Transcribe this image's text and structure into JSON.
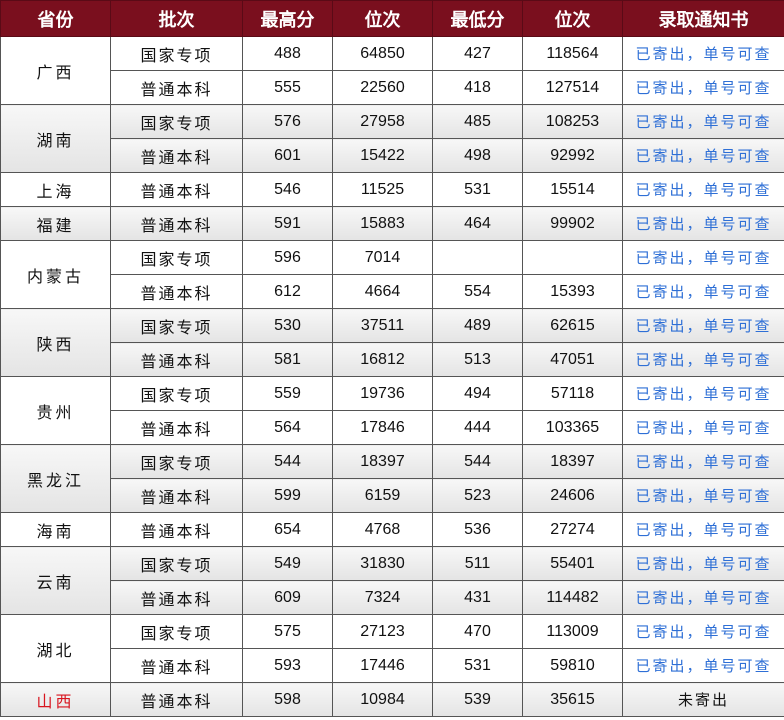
{
  "header": [
    "省份",
    "批次",
    "最高分",
    "位次",
    "最低分",
    "位次",
    "录取通知书"
  ],
  "groups": [
    {
      "province": "广西",
      "rows": [
        {
          "batch": "国家专项",
          "max": "488",
          "rank_max": "64850",
          "min": "427",
          "rank_min": "118564",
          "notice": "已寄出，单号可查"
        },
        {
          "batch": "普通本科",
          "max": "555",
          "rank_max": "22560",
          "min": "418",
          "rank_min": "127514",
          "notice": "已寄出，单号可查"
        }
      ]
    },
    {
      "province": "湖南",
      "rows": [
        {
          "batch": "国家专项",
          "max": "576",
          "rank_max": "27958",
          "min": "485",
          "rank_min": "108253",
          "notice": "已寄出，单号可查"
        },
        {
          "batch": "普通本科",
          "max": "601",
          "rank_max": "15422",
          "min": "498",
          "rank_min": "92992",
          "notice": "已寄出，单号可查"
        }
      ]
    },
    {
      "province": "上海",
      "rows": [
        {
          "batch": "普通本科",
          "max": "546",
          "rank_max": "11525",
          "min": "531",
          "rank_min": "15514",
          "notice": "已寄出，单号可查"
        }
      ]
    },
    {
      "province": "福建",
      "rows": [
        {
          "batch": "普通本科",
          "max": "591",
          "rank_max": "15883",
          "min": "464",
          "rank_min": "99902",
          "notice": "已寄出，单号可查"
        }
      ]
    },
    {
      "province": "内蒙古",
      "rows": [
        {
          "batch": "国家专项",
          "max": "596",
          "rank_max": "7014",
          "min": "",
          "rank_min": "",
          "notice": "已寄出，单号可查"
        },
        {
          "batch": "普通本科",
          "max": "612",
          "rank_max": "4664",
          "min": "554",
          "rank_min": "15393",
          "notice": "已寄出，单号可查"
        }
      ]
    },
    {
      "province": "陕西",
      "rows": [
        {
          "batch": "国家专项",
          "max": "530",
          "rank_max": "37511",
          "min": "489",
          "rank_min": "62615",
          "notice": "已寄出，单号可查"
        },
        {
          "batch": "普通本科",
          "max": "581",
          "rank_max": "16812",
          "min": "513",
          "rank_min": "47051",
          "notice": "已寄出，单号可查"
        }
      ]
    },
    {
      "province": "贵州",
      "rows": [
        {
          "batch": "国家专项",
          "max": "559",
          "rank_max": "19736",
          "min": "494",
          "rank_min": "57118",
          "notice": "已寄出，单号可查"
        },
        {
          "batch": "普通本科",
          "max": "564",
          "rank_max": "17846",
          "min": "444",
          "rank_min": "103365",
          "notice": "已寄出，单号可查"
        }
      ]
    },
    {
      "province": "黑龙江",
      "rows": [
        {
          "batch": "国家专项",
          "max": "544",
          "rank_max": "18397",
          "min": "544",
          "rank_min": "18397",
          "notice": "已寄出，单号可查"
        },
        {
          "batch": "普通本科",
          "max": "599",
          "rank_max": "6159",
          "min": "523",
          "rank_min": "24606",
          "notice": "已寄出，单号可查"
        }
      ]
    },
    {
      "province": "海南",
      "rows": [
        {
          "batch": "普通本科",
          "max": "654",
          "rank_max": "4768",
          "min": "536",
          "rank_min": "27274",
          "notice": "已寄出，单号可查"
        }
      ]
    },
    {
      "province": "云南",
      "rows": [
        {
          "batch": "国家专项",
          "max": "549",
          "rank_max": "31830",
          "min": "511",
          "rank_min": "55401",
          "notice": "已寄出，单号可查"
        },
        {
          "batch": "普通本科",
          "max": "609",
          "rank_max": "7324",
          "min": "431",
          "rank_min": "114482",
          "notice": "已寄出，单号可查"
        }
      ]
    },
    {
      "province": "湖北",
      "rows": [
        {
          "batch": "国家专项",
          "max": "575",
          "rank_max": "27123",
          "min": "470",
          "rank_min": "113009",
          "notice": "已寄出，单号可查"
        },
        {
          "batch": "普通本科",
          "max": "593",
          "rank_max": "17446",
          "min": "531",
          "rank_min": "59810",
          "notice": "已寄出，单号可查"
        }
      ]
    },
    {
      "province": "山西",
      "highlight": true,
      "pending": true,
      "rows": [
        {
          "batch": "普通本科",
          "max": "598",
          "rank_max": "10984",
          "min": "539",
          "rank_min": "35615",
          "notice": "未寄出"
        }
      ]
    }
  ],
  "colors": {
    "header_bg": "#7a0f1e",
    "notice_link": "#2e6fd6",
    "highlight_province": "#d8141e"
  }
}
